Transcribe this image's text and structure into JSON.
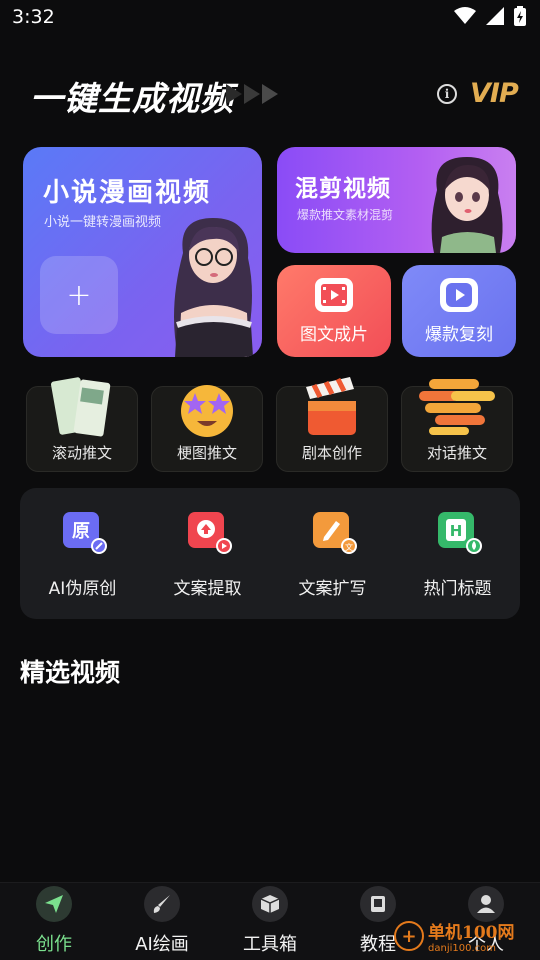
{
  "status_bar": {
    "time": "3:32"
  },
  "header": {
    "title": "一键生成视频",
    "vip": "VIP",
    "info_glyph": "i"
  },
  "cards": {
    "novel": {
      "title": "小说漫画视频",
      "subtitle": "小说一键转漫画视频",
      "add_glyph": "+"
    },
    "mix": {
      "title": "混剪视频",
      "subtitle": "爆款推文素材混剪"
    },
    "picture_text": {
      "label": "图文成片"
    },
    "hot_copy": {
      "label": "爆款复刻"
    }
  },
  "tiles": [
    {
      "label": "滚动推文"
    },
    {
      "label": "梗图推文"
    },
    {
      "label": "剧本创作"
    },
    {
      "label": "对话推文"
    }
  ],
  "tools": [
    {
      "label": "AI伪原创",
      "glyph": "原",
      "color": "#6b6cf3"
    },
    {
      "label": "文案提取",
      "glyph": "",
      "color": "#f0454f"
    },
    {
      "label": "文案扩写",
      "glyph": "",
      "color": "#f39a3c"
    },
    {
      "label": "热门标题",
      "glyph": "H",
      "color": "#35b86a"
    }
  ],
  "section": {
    "title": "精选视频"
  },
  "bottom_nav": [
    {
      "label": "创作",
      "icon": "send-icon",
      "active": true
    },
    {
      "label": "AI绘画",
      "icon": "brush-icon",
      "active": false
    },
    {
      "label": "工具箱",
      "icon": "box-icon",
      "active": false
    },
    {
      "label": "教程",
      "icon": "book-icon",
      "active": false
    },
    {
      "label": "个人",
      "icon": "person-icon",
      "active": false
    }
  ],
  "watermark": {
    "text": "单机100网",
    "url": "danji100.com",
    "glyph": "+"
  },
  "colors": {
    "accent_green": "#7be08e",
    "vip_gold": "#e2ad52",
    "background": "#0c0c0d"
  }
}
